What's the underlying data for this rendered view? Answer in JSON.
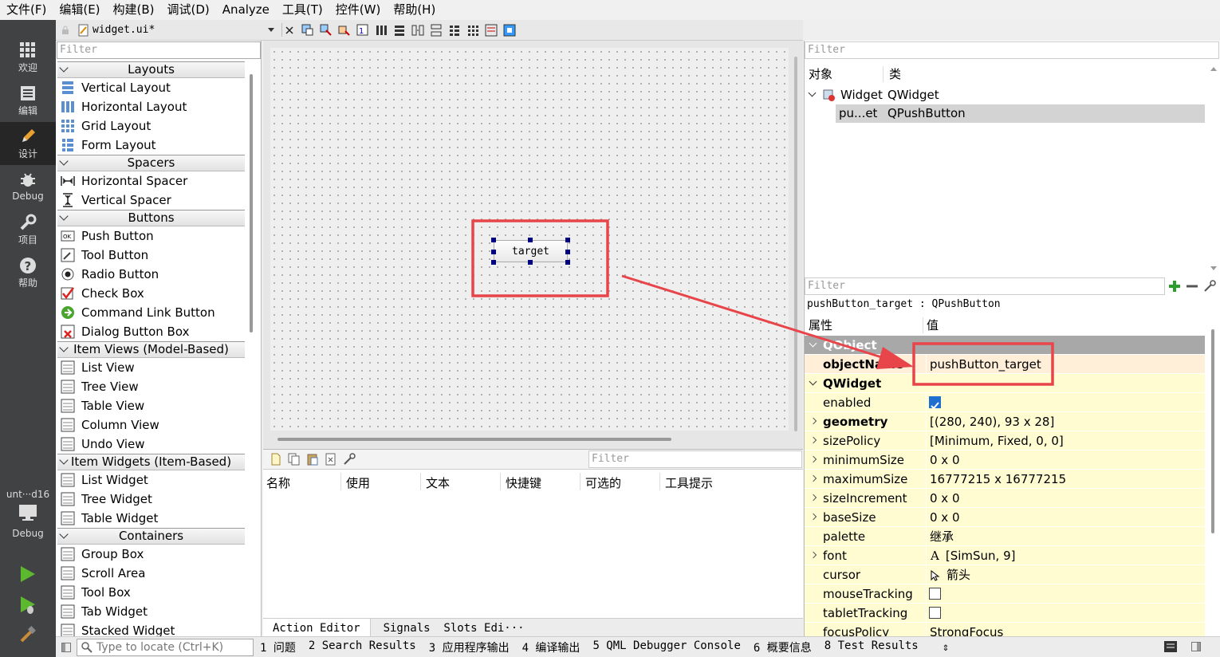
{
  "menubar": [
    "文件(F)",
    "编辑(E)",
    "构建(B)",
    "调试(D)",
    "Analyze",
    "工具(T)",
    "控件(W)",
    "帮助(H)"
  ],
  "modes": [
    {
      "label": "欢迎",
      "icon": "grid-icon"
    },
    {
      "label": "编辑",
      "icon": "document-icon"
    },
    {
      "label": "设计",
      "icon": "pencil-icon"
    },
    {
      "label": "Debug",
      "icon": "bug-icon"
    },
    {
      "label": "项目",
      "icon": "wrench-icon"
    },
    {
      "label": "帮助",
      "icon": "help-icon"
    }
  ],
  "kit": {
    "name": "unt···d16",
    "mode": "Debug"
  },
  "doc_toolbar": {
    "filename": "widget.ui*"
  },
  "widget_box": {
    "filter_placeholder": "Filter",
    "categories": [
      {
        "title": "Layouts",
        "items": [
          "Vertical Layout",
          "Horizontal Layout",
          "Grid Layout",
          "Form Layout"
        ]
      },
      {
        "title": "Spacers",
        "items": [
          "Horizontal Spacer",
          "Vertical Spacer"
        ]
      },
      {
        "title": "Buttons",
        "items": [
          "Push Button",
          "Tool Button",
          "Radio Button",
          "Check Box",
          "Command Link Button",
          "Dialog Button Box"
        ]
      },
      {
        "title": "Item Views (Model-Based)",
        "items": [
          "List View",
          "Tree View",
          "Table View",
          "Column View",
          "Undo View"
        ]
      },
      {
        "title": "Item Widgets (Item-Based)",
        "items": [
          "List Widget",
          "Tree Widget",
          "Table Widget"
        ]
      },
      {
        "title": "Containers",
        "items": [
          "Group Box",
          "Scroll Area",
          "Tool Box",
          "Tab Widget",
          "Stacked Widget"
        ]
      }
    ]
  },
  "canvas": {
    "button_label": "target"
  },
  "action_editor": {
    "filter_placeholder": "Filter",
    "columns": [
      "名称",
      "使用",
      "文本",
      "快捷键",
      "可选的",
      "工具提示"
    ],
    "tabs": [
      "Action Editor",
      "Signals  Slots Edi···"
    ]
  },
  "object_inspector": {
    "filter_placeholder": "Filter",
    "headers": [
      "对象",
      "类"
    ],
    "rows": [
      {
        "object": "Widget",
        "class": "QWidget"
      },
      {
        "object": "pu...et",
        "class": "QPushButton"
      }
    ]
  },
  "property_editor": {
    "filter_placeholder": "Filter",
    "subtitle": "pushButton_target : QPushButton",
    "headers": [
      "属性",
      "值"
    ],
    "rows": [
      {
        "name": "QObject",
        "value": "",
        "kind": "group"
      },
      {
        "name": "objectName",
        "value": "pushButton_target",
        "kind": "prop",
        "bold": true,
        "bg": "#ffeed8"
      },
      {
        "name": "QWidget",
        "value": "",
        "kind": "group2"
      },
      {
        "name": "enabled",
        "value": "",
        "kind": "check",
        "checked": true
      },
      {
        "name": "geometry",
        "value": "[(280, 240), 93 x 28]",
        "kind": "prop",
        "bold": true,
        "expandable": true
      },
      {
        "name": "sizePolicy",
        "value": "[Minimum, Fixed, 0, 0]",
        "kind": "prop",
        "expandable": true
      },
      {
        "name": "minimumSize",
        "value": "0 x 0",
        "kind": "prop",
        "expandable": true
      },
      {
        "name": "maximumSize",
        "value": "16777215 x 16777215",
        "kind": "prop",
        "expandable": true
      },
      {
        "name": "sizeIncrement",
        "value": "0 x 0",
        "kind": "prop",
        "expandable": true
      },
      {
        "name": "baseSize",
        "value": "0 x 0",
        "kind": "prop",
        "expandable": true
      },
      {
        "name": "palette",
        "value": "继承",
        "kind": "prop"
      },
      {
        "name": "font",
        "value": "[SimSun, 9]",
        "kind": "font",
        "expandable": true
      },
      {
        "name": "cursor",
        "value": "箭头",
        "kind": "cursor"
      },
      {
        "name": "mouseTracking",
        "value": "",
        "kind": "check",
        "checked": false
      },
      {
        "name": "tabletTracking",
        "value": "",
        "kind": "check",
        "checked": false
      },
      {
        "name": "focusPolicy",
        "value": "StrongFocus",
        "kind": "prop"
      }
    ]
  },
  "statusbar": {
    "locate_placeholder": "Type to locate (Ctrl+K)",
    "panes": [
      "1 问题",
      "2 Search Results",
      "3 应用程序输出",
      "4 编译输出",
      "5 QML Debugger Console",
      "6 概要信息",
      "8 Test Results"
    ]
  },
  "colors": {
    "annotation": "#e8454a",
    "group_bg": "#a8a8a8",
    "prop_bg": "#fffcd2",
    "mode_bar": "#404244"
  }
}
